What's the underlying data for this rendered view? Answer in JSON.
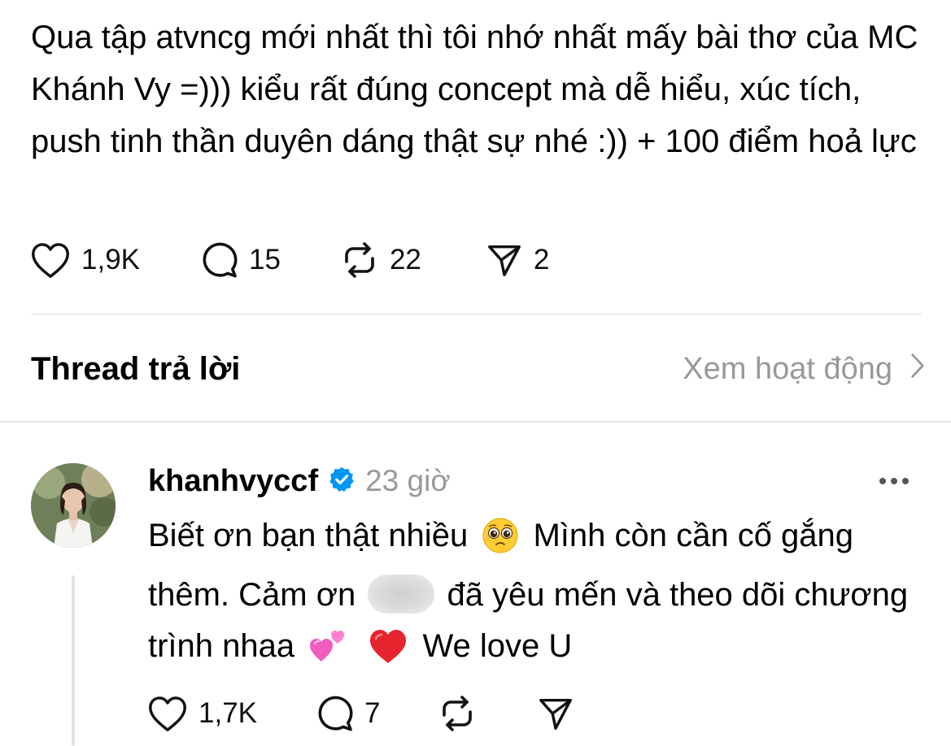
{
  "post": {
    "text": "Qua tập atvncg mới nhất thì tôi nhớ nhất mấy bài thơ của MC Khánh Vy =))) kiểu rất đúng concept mà dễ hiểu, xúc tích, push tinh thần duyên dáng thật sự nhé :)) + 100 điểm hoả lực",
    "likes": "1,9K",
    "comments": "15",
    "reposts": "22",
    "shares": "2"
  },
  "replies_section": {
    "title": "Thread trả lời",
    "see_activity": "Xem hoạt động"
  },
  "reply": {
    "username": "khanhvyccf",
    "time": "23 giờ",
    "text_part1": "Biết ơn bạn thật nhiều",
    "text_part2": "Mình còn cần cố gắng thêm. Cảm ơn",
    "text_part3": "đã yêu mến và theo dõi chương trình nhaa",
    "text_part4": "We love U",
    "likes": "1,7K",
    "comments": "7"
  },
  "icons": {
    "like": "heart-icon",
    "comment": "comment-bubble-icon",
    "repost": "repost-icon",
    "share": "send-icon",
    "verified": "verified-badge-icon",
    "more": "more-dots-icon",
    "chevron": "chevron-right-icon",
    "emoji_pleading": "pleading-face-emoji",
    "emoji_hearts": "two-hearts-emoji",
    "emoji_heart": "red-heart-emoji"
  },
  "colors": {
    "text": "#000000",
    "secondary": "#999999",
    "verified": "#0095f6",
    "divider": "#dcdcdc"
  }
}
